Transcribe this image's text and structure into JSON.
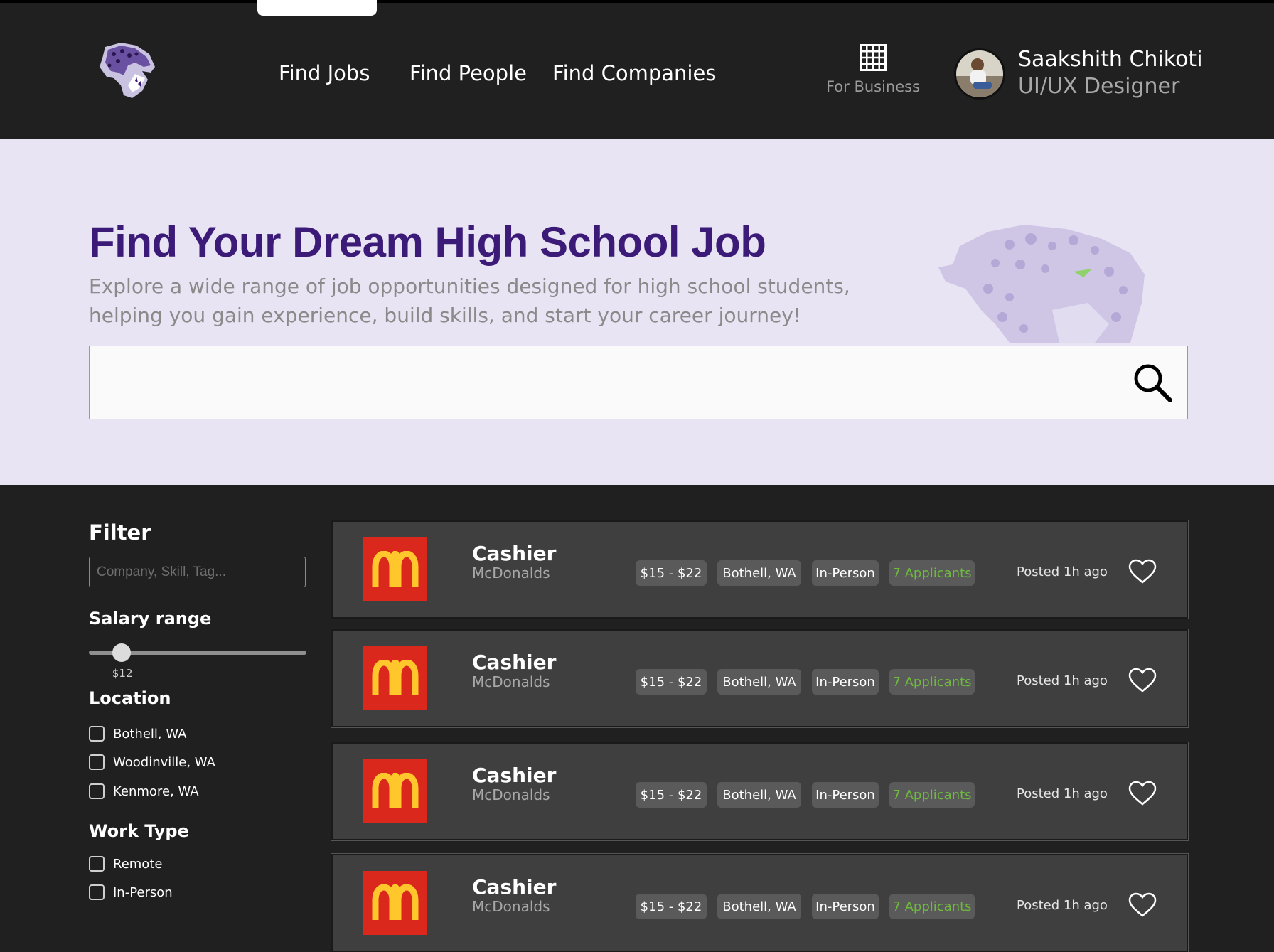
{
  "nav": {
    "links": [
      "Find Jobs",
      "Find People",
      "Find Companies"
    ],
    "business_label": "For Business"
  },
  "user": {
    "name": "Saakshith Chikoti",
    "role": "UI/UX Designer"
  },
  "hero": {
    "title": "Find Your Dream High School Job",
    "subtitle": "Explore a wide range of job opportunities designed for high school students, helping you gain experience, build skills, and start your career journey!",
    "search_value": ""
  },
  "filters": {
    "heading": "Filter",
    "search_placeholder": "Company, Skill, Tag...",
    "salary_heading": "Salary range",
    "salary_value": "$12",
    "salary_fraction": 0.15,
    "location_heading": "Location",
    "locations": [
      "Bothell, WA",
      "Woodinville, WA",
      "Kenmore, WA"
    ],
    "worktype_heading": "Work Type",
    "worktypes": [
      "Remote",
      "In-Person"
    ]
  },
  "jobs": [
    {
      "title": "Cashier",
      "company": "McDonalds",
      "salary": "$15 - $22",
      "location": "Bothell, WA",
      "type": "In-Person",
      "applicants": "7 Applicants",
      "posted": "Posted 1h ago"
    },
    {
      "title": "Cashier",
      "company": "McDonalds",
      "salary": "$15 - $22",
      "location": "Bothell, WA",
      "type": "In-Person",
      "applicants": "7 Applicants",
      "posted": "Posted 1h ago"
    },
    {
      "title": "Cashier",
      "company": "McDonalds",
      "salary": "$15 - $22",
      "location": "Bothell, WA",
      "type": "In-Person",
      "applicants": "7 Applicants",
      "posted": "Posted 1h ago"
    },
    {
      "title": "Cashier",
      "company": "McDonalds",
      "salary": "$15 - $22",
      "location": "Bothell, WA",
      "type": "In-Person",
      "applicants": "7 Applicants",
      "posted": "Posted 1h ago"
    }
  ],
  "colors": {
    "brand_purple": "#3b1a78",
    "hero_bg": "#e8e4f3",
    "mcd_red": "#da291c",
    "mcd_yellow": "#ffc72c",
    "applicants_green": "#6fba3e"
  }
}
